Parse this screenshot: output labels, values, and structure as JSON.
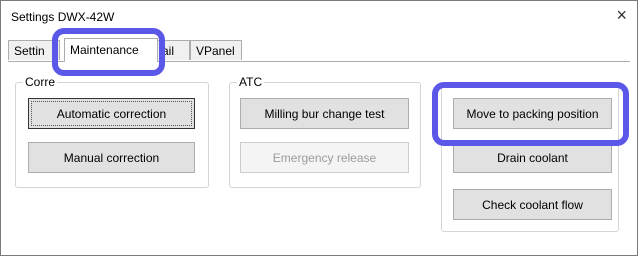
{
  "window": {
    "title": "Settings DWX-42W",
    "close_glyph": "×"
  },
  "tabs": [
    {
      "label": "Settin"
    },
    {
      "label": "Maintenance"
    },
    {
      "label": "ail"
    },
    {
      "label": "VPanel"
    }
  ],
  "groups": {
    "correction": {
      "label": "Corre",
      "buttons": [
        {
          "label": "Automatic correction"
        },
        {
          "label": "Manual correction"
        }
      ]
    },
    "atc": {
      "label": "ATC",
      "buttons": [
        {
          "label": "Milling bur change test"
        },
        {
          "label": "Emergency release"
        }
      ]
    },
    "other": {
      "buttons": [
        {
          "label": "Move to packing position"
        },
        {
          "label": "Drain coolant"
        },
        {
          "label": "Check coolant flow"
        }
      ]
    }
  },
  "highlight": {
    "color": "#5b57e8"
  }
}
